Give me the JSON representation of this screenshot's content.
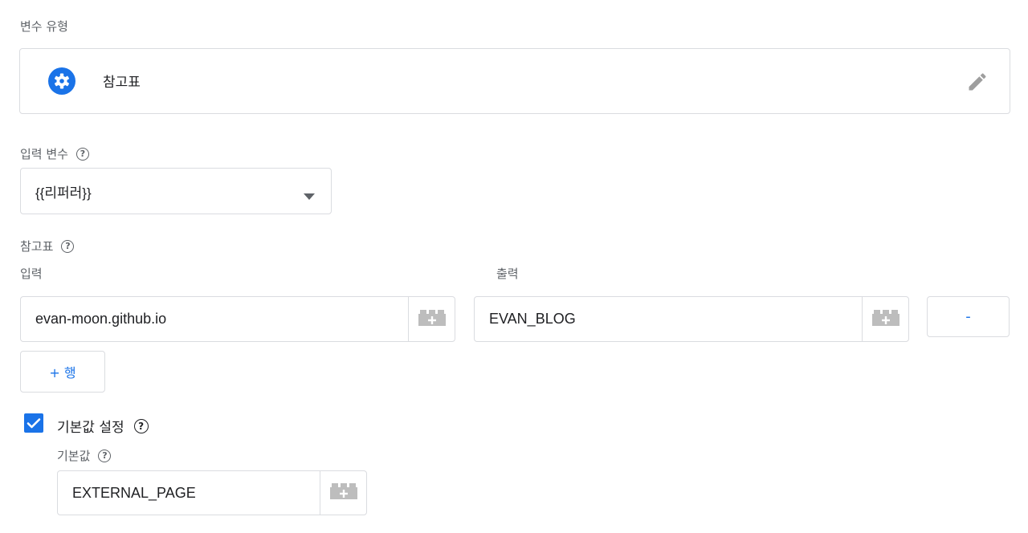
{
  "variable_type": {
    "label": "변수 유형",
    "name": "참고표",
    "icon": "gear-icon",
    "edit_icon": "pencil-icon"
  },
  "input_variable": {
    "label": "입력 변수",
    "help": "?",
    "selected": "{{리퍼러}}"
  },
  "lookup_table": {
    "label": "참고표",
    "help": "?",
    "col_input": "입력",
    "col_output": "출력",
    "rows": [
      {
        "input": "evan-moon.github.io",
        "output": "EVAN_BLOG",
        "remove_label": "-"
      }
    ],
    "add_row_label": "+ 행"
  },
  "default_value": {
    "checkbox_label": "기본값 설정",
    "checked": true,
    "help": "?",
    "field_label": "기본값",
    "value": "EXTERNAL_PAGE"
  },
  "colors": {
    "accent": "#1a73e8",
    "border": "#dadce0",
    "text_secondary": "#5f6368",
    "icon_gray": "#bdbdbd"
  }
}
